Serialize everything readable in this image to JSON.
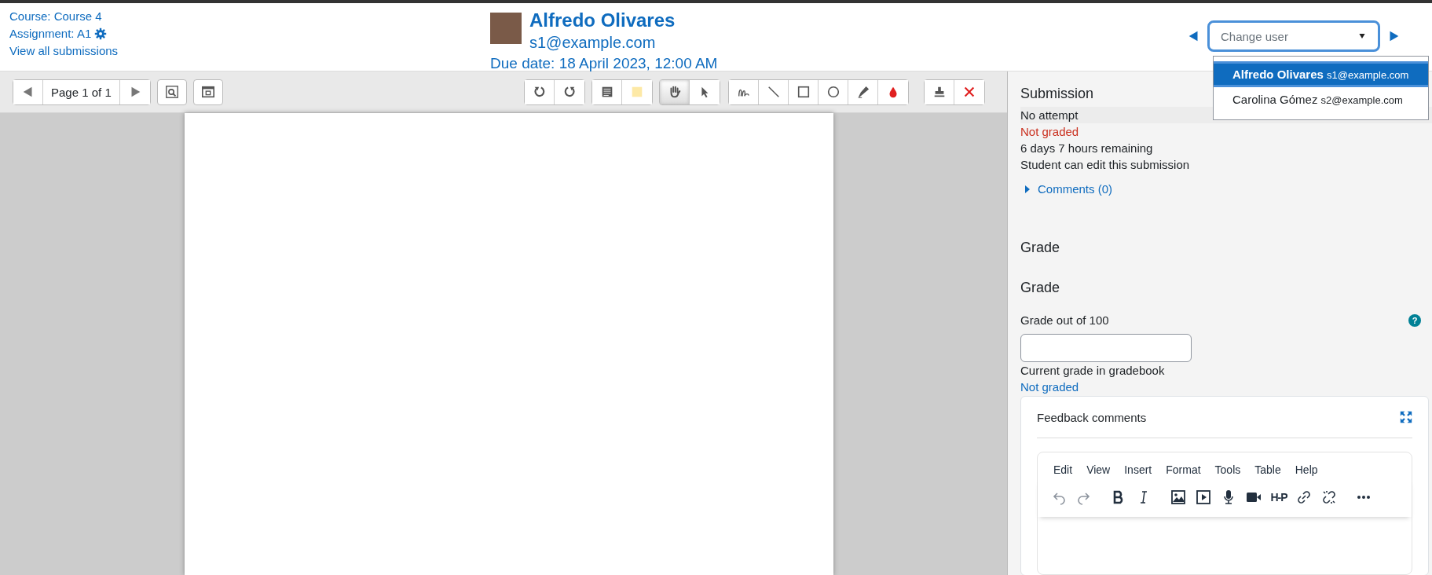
{
  "header": {
    "links": [
      {
        "text": "Course: Course 4",
        "settings": false
      },
      {
        "text": "Assignment: A1",
        "settings": true
      },
      {
        "text": "View all submissions",
        "settings": false
      }
    ],
    "user": {
      "name": "Alfredo Olivares",
      "email": "s1@example.com",
      "due": "Due date: 18 April 2023, 12:00 AM"
    },
    "user_select": {
      "placeholder": "Change user",
      "expanded": true,
      "options": [
        {
          "name": "Alfredo Olivares",
          "email": "s1@example.com",
          "selected": true
        },
        {
          "name": "Carolina Gómez",
          "email": "s2@example.com",
          "selected": false
        }
      ]
    }
  },
  "pdf_toolbar": {
    "page_label": "Page 1 of 1",
    "tool_groups": [
      [
        {
          "selected": false
        },
        {
          "selected": false
        }
      ],
      [
        {
          "selected": false
        },
        {
          "selected": false
        }
      ],
      [
        {
          "selected": true
        },
        {
          "selected": false
        }
      ],
      [
        {
          "selected": false
        },
        {
          "selected": false
        },
        {
          "selected": false
        },
        {
          "selected": false
        },
        {
          "selected": false
        },
        {
          "selected": false
        }
      ],
      [
        {
          "selected": false
        },
        {
          "selected": false
        }
      ]
    ]
  },
  "submission": {
    "heading": "Submission",
    "status": [
      {
        "text": "No attempt",
        "kind": "highlight"
      },
      {
        "text": "Not graded",
        "kind": "warning"
      },
      {
        "text": "6 days 7 hours remaining",
        "kind": "plain"
      },
      {
        "text": "Student can edit this submission",
        "kind": "plain"
      }
    ],
    "comments": {
      "label": "Comments (0)",
      "expanded": false
    }
  },
  "grade": {
    "section_heading": "Grade",
    "heading": "Grade",
    "label": "Grade out of 100",
    "help": "?",
    "current_label": "Current grade in gradebook",
    "current_value": "Not graded"
  },
  "feedback": {
    "title": "Feedback comments",
    "menu": [
      "Edit",
      "View",
      "Insert",
      "Format",
      "Tools",
      "Table",
      "Help"
    ],
    "toolbar": [
      {
        "kind": "undo",
        "disabled": true
      },
      {
        "kind": "redo",
        "disabled": true
      },
      {
        "kind": "bold",
        "disabled": false
      },
      {
        "kind": "italic",
        "disabled": false
      },
      {
        "kind": "image",
        "disabled": false
      },
      {
        "kind": "media",
        "disabled": false
      },
      {
        "kind": "audio",
        "disabled": false
      },
      {
        "kind": "video",
        "disabled": false
      },
      {
        "kind": "h5p",
        "disabled": false,
        "text": "H-P"
      },
      {
        "kind": "link",
        "disabled": false
      },
      {
        "kind": "unlink",
        "disabled": false
      },
      {
        "kind": "more",
        "disabled": false
      }
    ]
  }
}
